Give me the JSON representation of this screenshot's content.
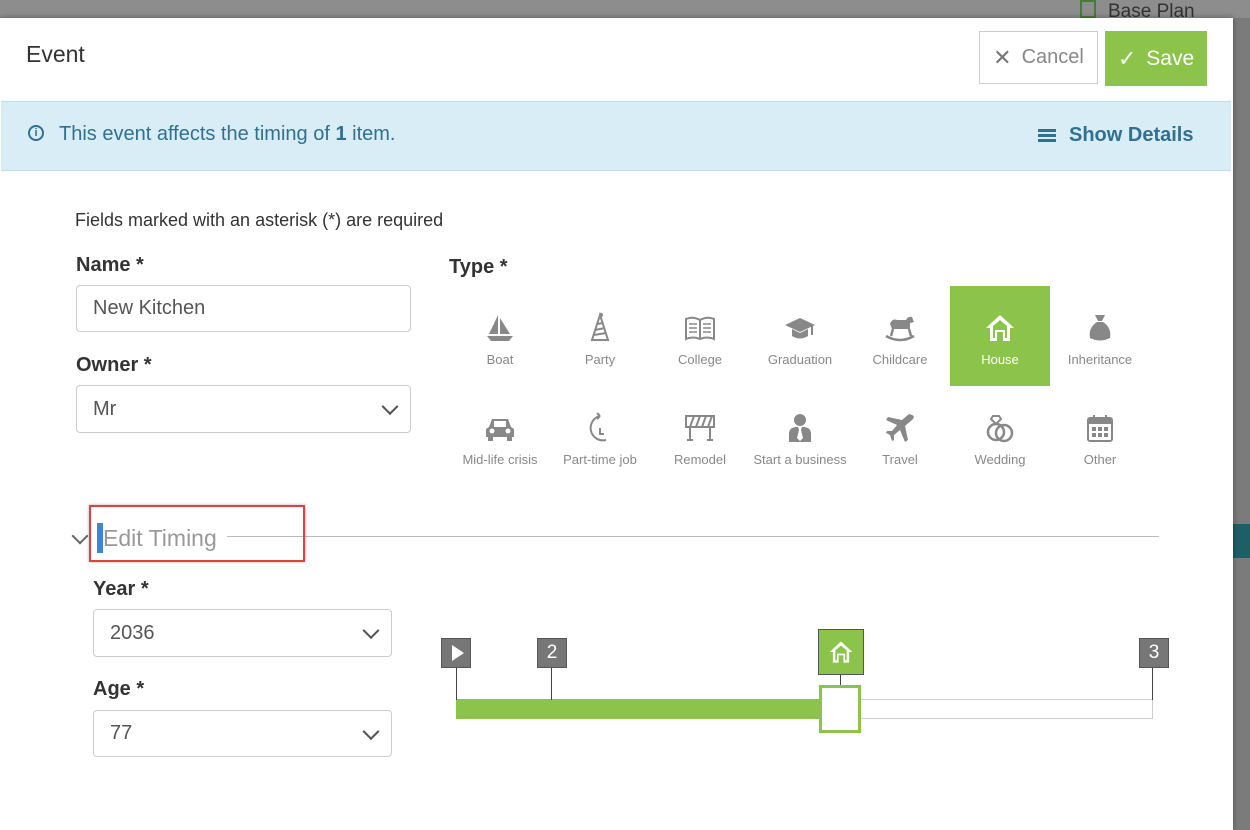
{
  "background": {
    "plan_label": "Base Plan"
  },
  "modal": {
    "title": "Event",
    "cancel_label": "Cancel",
    "save_label": "Save"
  },
  "banner": {
    "text_before": "This event affects the timing of ",
    "count": "1",
    "text_after": " item.",
    "show_details_label": "Show Details"
  },
  "form": {
    "required_hint": "Fields marked with an asterisk (*) are required",
    "name_label": "Name *",
    "name_value": "New Kitchen",
    "owner_label": "Owner *",
    "owner_value": "Mr",
    "type_label": "Type *",
    "types": [
      {
        "label": "Boat",
        "icon": "boat-icon",
        "selected": false
      },
      {
        "label": "Party",
        "icon": "party-hat-icon",
        "selected": false
      },
      {
        "label": "College",
        "icon": "book-icon",
        "selected": false
      },
      {
        "label": "Graduation",
        "icon": "graduation-cap-icon",
        "selected": false
      },
      {
        "label": "Childcare",
        "icon": "rocking-horse-icon",
        "selected": false
      },
      {
        "label": "House",
        "icon": "house-icon",
        "selected": true
      },
      {
        "label": "Inheritance",
        "icon": "money-bag-icon",
        "selected": false
      },
      {
        "label": "Mid-life crisis",
        "icon": "car-icon",
        "selected": false
      },
      {
        "label": "Part-time job",
        "icon": "clock-icon",
        "selected": false
      },
      {
        "label": "Remodel",
        "icon": "barrier-icon",
        "selected": false
      },
      {
        "label": "Start a business",
        "icon": "businessman-icon",
        "selected": false
      },
      {
        "label": "Travel",
        "icon": "airplane-icon",
        "selected": false
      },
      {
        "label": "Wedding",
        "icon": "rings-icon",
        "selected": false
      },
      {
        "label": "Other",
        "icon": "calendar-icon",
        "selected": false
      }
    ]
  },
  "timing": {
    "section_title": "Edit Timing",
    "year_label": "Year *",
    "year_value": "2036",
    "age_label": "Age *",
    "age_value": "77",
    "markers": [
      {
        "label": "",
        "icon": "play-icon"
      },
      {
        "label": "2"
      },
      {
        "label": "",
        "icon": "house-icon"
      },
      {
        "label": "3"
      }
    ],
    "progress_fraction": 0.55
  },
  "colors": {
    "accent_green": "#8cc34b",
    "info_bg": "#d9edf6",
    "info_text": "#31708f",
    "highlight_red": "#e04040"
  }
}
